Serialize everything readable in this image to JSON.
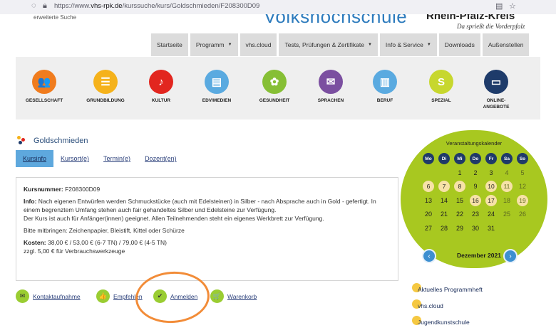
{
  "browser": {
    "url_prefix": "https://www.",
    "url_host": "vhs-rpk.de",
    "url_path": "/kurssuche/kurs/Goldschmieden/F208300D09"
  },
  "header": {
    "advanced_search": "erweiterte Suche",
    "org_name": "Volkshochschule",
    "region": "Rhein-Pfalz-Kreis",
    "tagline": "Da sprießt die Vorderpfalz"
  },
  "topnav": [
    {
      "label": "Startseite",
      "dropdown": false
    },
    {
      "label": "Programm",
      "dropdown": true
    },
    {
      "label": "vhs.cloud",
      "dropdown": false
    },
    {
      "label": "Tests, Prüfungen & Zertifikate",
      "dropdown": true
    },
    {
      "label": "Info & Service",
      "dropdown": true
    },
    {
      "label": "Downloads",
      "dropdown": false
    },
    {
      "label": "Außenstellen",
      "dropdown": false
    }
  ],
  "categories": [
    {
      "label": "GESELLSCHAFT",
      "icon": "people-icon",
      "color": "#f07c1e",
      "glyph": "👥"
    },
    {
      "label": "GRUNDBILDUNG",
      "icon": "abc-icon",
      "color": "#f5b21b",
      "glyph": "☰"
    },
    {
      "label": "KULTUR",
      "icon": "music-icon",
      "color": "#e2261f",
      "glyph": "♪"
    },
    {
      "label": "EDV/MEDIEN",
      "icon": "monitor-icon",
      "color": "#5aaae0",
      "glyph": "▤"
    },
    {
      "label": "GESUNDHEIT",
      "icon": "health-icon",
      "color": "#86bf35",
      "glyph": "✿"
    },
    {
      "label": "SPRACHEN",
      "icon": "speech-icon",
      "color": "#7b4fa0",
      "glyph": "✉"
    },
    {
      "label": "BERUF",
      "icon": "book-icon",
      "color": "#5aaae0",
      "glyph": "▥"
    },
    {
      "label": "SPEZIAL",
      "icon": "s-icon",
      "color": "#c7d72e",
      "glyph": "S"
    },
    {
      "label": "ONLINE-\nANGEBOTE",
      "icon": "laptop-icon",
      "color": "#1e3b6a",
      "glyph": "▭"
    }
  ],
  "course": {
    "title": "Goldschmieden",
    "tabs": [
      "Kursinfo",
      "Kursort(e)",
      "Termin(e)",
      "Dozent(en)"
    ],
    "active_tab": "Kursinfo",
    "nummer_label": "Kursnummer:",
    "nummer": "F208300D09",
    "info_label": "Info:",
    "info_text": "Nach eigenen Entwürfen werden Schmuckstücke (auch mit Edelsteinen) in Silber - nach Absprache auch in Gold - gefertigt. In einem begrenztem Umfang stehen auch fair gehandeltes Silber und Edelsteine zur Verfügung.",
    "info_text2": "Der Kurs ist auch für Anfänger(innen) geeignet. Allen Teilnehmenden steht ein eigenes Werkbrett zur Verfügung.",
    "bring": "Bitte mitbringen: Zeichenpapier, Bleistift, Kittel oder Schürze",
    "kosten_label": "Kosten:",
    "kosten": "38,00 € / 53,00 € (6-7 TN) / 79,00 € (4-5 TN)",
    "kosten_extra": "zzgl. 5,00 € für Verbrauchswerkzeuge"
  },
  "actions": [
    {
      "label": "Kontaktaufnahme",
      "icon": "mail-icon",
      "glyph": "✉"
    },
    {
      "label": "Empfehlen",
      "icon": "thumbs-up-icon",
      "glyph": "👍"
    },
    {
      "label": "Anmelden",
      "icon": "check-icon",
      "glyph": "✔"
    },
    {
      "label": "Warenkorb",
      "icon": "cart-icon",
      "glyph": "🛒"
    }
  ],
  "calendar": {
    "title": "Veranstaltungskalender",
    "weekdays": [
      "Mo",
      "Di",
      "Mi",
      "Do",
      "Fr",
      "Sa",
      "So"
    ],
    "month": "Dezember 2021",
    "weeks": [
      [
        {
          "d": ""
        },
        {
          "d": ""
        },
        {
          "d": "1"
        },
        {
          "d": "2"
        },
        {
          "d": "3"
        },
        {
          "d": "4",
          "m": 1
        },
        {
          "d": "5",
          "m": 1
        }
      ],
      [
        {
          "d": "6",
          "e": 1
        },
        {
          "d": "7",
          "e": 1
        },
        {
          "d": "8",
          "e": 1
        },
        {
          "d": "9"
        },
        {
          "d": "10",
          "e": 1
        },
        {
          "d": "11",
          "e": 1,
          "m": 1
        },
        {
          "d": "12",
          "m": 1
        }
      ],
      [
        {
          "d": "13"
        },
        {
          "d": "14"
        },
        {
          "d": "15"
        },
        {
          "d": "16",
          "e": 1
        },
        {
          "d": "17",
          "e": 1
        },
        {
          "d": "18",
          "m": 1
        },
        {
          "d": "19",
          "e": 1,
          "m": 1
        }
      ],
      [
        {
          "d": "20"
        },
        {
          "d": "21"
        },
        {
          "d": "22"
        },
        {
          "d": "23"
        },
        {
          "d": "24"
        },
        {
          "d": "25",
          "m": 1
        },
        {
          "d": "26",
          "m": 1
        }
      ],
      [
        {
          "d": "27"
        },
        {
          "d": "28"
        },
        {
          "d": "29"
        },
        {
          "d": "30"
        },
        {
          "d": "31"
        },
        {
          "d": ""
        },
        {
          "d": ""
        }
      ]
    ]
  },
  "side_links": [
    "Aktuelles Programmheft",
    "vhs.cloud",
    "Jugendkunstschule"
  ]
}
